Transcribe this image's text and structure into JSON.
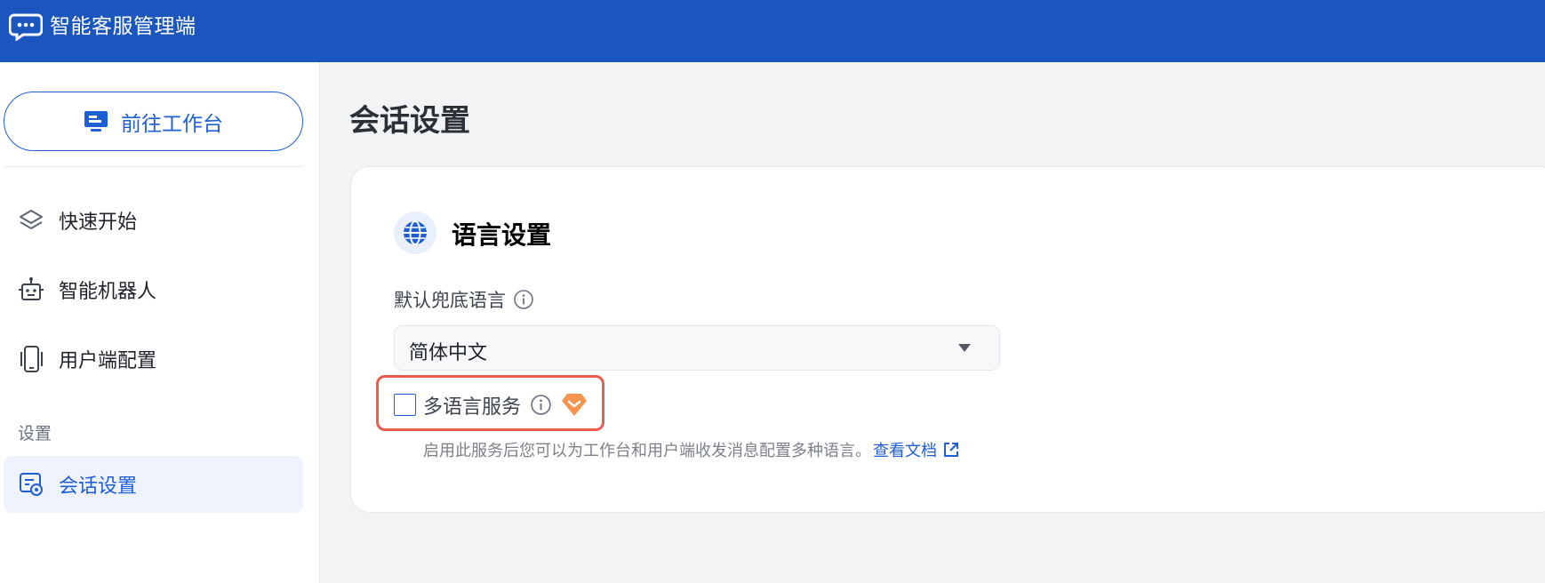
{
  "header": {
    "app_title": "智能客服管理端",
    "logo_icon": "chat-bubble-icon",
    "bg_color": "#1a56be"
  },
  "sidebar": {
    "workbench_button": {
      "label": "前往工作台",
      "icon": "monitor-icon"
    },
    "items": [
      {
        "label": "快速开始",
        "icon": "layers-icon"
      },
      {
        "label": "智能机器人",
        "icon": "robot-icon"
      },
      {
        "label": "用户端配置",
        "icon": "phone-icon"
      }
    ],
    "section_title": "设置",
    "settings_items": [
      {
        "label": "会话设置",
        "icon": "chat-settings-icon",
        "active": true
      }
    ]
  },
  "main": {
    "page_title": "会话设置",
    "card": {
      "heading": "语言设置",
      "heading_icon": "globe-icon",
      "default_language": {
        "label": "默认兜底语言",
        "value": "简体中文"
      },
      "multi_language": {
        "label": "多语言服务",
        "checked": false,
        "badge_icon": "premium-gem-icon",
        "description": "启用此服务后您可以为工作台和用户端收发消息配置多种语言。",
        "doc_link": "查看文档"
      }
    }
  },
  "colors": {
    "accent": "#1f5fd6",
    "highlight": "#e95c50",
    "premium": "#f5944f"
  }
}
